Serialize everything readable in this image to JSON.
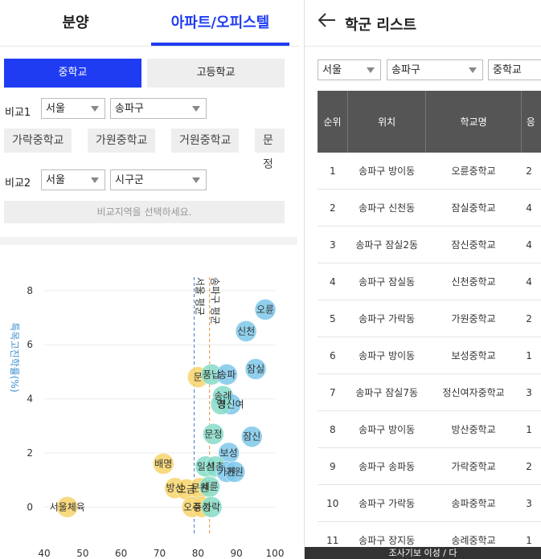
{
  "tabs": {
    "sale": "분양",
    "apt": "아파트/오피스텔"
  },
  "segment": {
    "middle": "중학교",
    "high": "고등학교"
  },
  "compare1": {
    "label": "비교1",
    "city": "서울",
    "district": "송파구"
  },
  "chips": [
    "가락중학교",
    "가원중학교",
    "거원중학교",
    "문정"
  ],
  "compare2": {
    "label": "비교2",
    "city": "서울",
    "district": "시구군"
  },
  "compare_message": "비교지역을 선택하세요.",
  "chart_data": {
    "type": "scatter",
    "ylabel": "특목고진학률(%)",
    "xlim": [
      40,
      100
    ],
    "ylim": [
      -1,
      8.5
    ],
    "xticks": [
      40,
      50,
      60,
      70,
      80,
      90,
      100
    ],
    "yticks": [
      0,
      2,
      4,
      6,
      8
    ],
    "reference_lines": [
      {
        "label": "서울 평균",
        "x": 79,
        "color": "#4a78c4"
      },
      {
        "label": "송파구 평균",
        "x": 83,
        "color": "#e0923a"
      }
    ],
    "points": [
      {
        "label": "오륜",
        "x": 97.5,
        "y": 7.3,
        "group": "blue"
      },
      {
        "label": "신천",
        "x": 92.5,
        "y": 6.5,
        "group": "blue"
      },
      {
        "label": "잠실",
        "x": 95,
        "y": 5.1,
        "group": "blue"
      },
      {
        "label": "문",
        "x": 80,
        "y": 4.8,
        "group": "yellow"
      },
      {
        "label": "풍납",
        "x": 83.5,
        "y": 4.9,
        "group": "teal"
      },
      {
        "label": "송파",
        "x": 87.5,
        "y": 4.9,
        "group": "blue"
      },
      {
        "label": "송례",
        "x": 86.5,
        "y": 4.1,
        "group": "teal"
      },
      {
        "label": "정신여",
        "x": 88.5,
        "y": 3.8,
        "group": "blue"
      },
      {
        "label": "영",
        "x": 86,
        "y": 3.8,
        "group": "teal"
      },
      {
        "label": "문정",
        "x": 84,
        "y": 2.7,
        "group": "teal"
      },
      {
        "label": "잠신",
        "x": 94,
        "y": 2.6,
        "group": "blue"
      },
      {
        "label": "보성",
        "x": 88,
        "y": 2.0,
        "group": "blue"
      },
      {
        "label": "배명",
        "x": 71,
        "y": 1.6,
        "group": "yellow"
      },
      {
        "label": "일신",
        "x": 82,
        "y": 1.5,
        "group": "teal"
      },
      {
        "label": "석촌",
        "x": 84.5,
        "y": 1.5,
        "group": "teal"
      },
      {
        "label": "가원",
        "x": 87.5,
        "y": 1.3,
        "group": "blue"
      },
      {
        "label": "거원",
        "x": 89.5,
        "y": 1.3,
        "group": "blue"
      },
      {
        "label": "방산",
        "x": 74,
        "y": 0.7,
        "group": "yellow"
      },
      {
        "label": "오금",
        "x": 77,
        "y": 0.65,
        "group": "yellow"
      },
      {
        "label": "문원",
        "x": 80.5,
        "y": 0.7,
        "group": "yellow"
      },
      {
        "label": "세륜",
        "x": 83,
        "y": 0.75,
        "group": "teal"
      },
      {
        "label": "오주",
        "x": 78.5,
        "y": 0.0,
        "group": "yellow"
      },
      {
        "label": "풍성",
        "x": 81,
        "y": 0.0,
        "group": "yellow"
      },
      {
        "label": "가락",
        "x": 83.5,
        "y": 0.0,
        "group": "teal"
      },
      {
        "label": "서울체육",
        "x": 46,
        "y": 0.0,
        "group": "yellow"
      }
    ],
    "colors": {
      "blue": "#7ec8ea",
      "teal": "#86dcc8",
      "yellow": "#f7d36a"
    }
  },
  "right": {
    "title": "학군 리스트",
    "filters": {
      "city": "서울",
      "district": "송파구",
      "level": "중학교"
    },
    "columns": [
      "순위",
      "위치",
      "학교명",
      "응"
    ],
    "rows": [
      [
        "1",
        "송파구 방이동",
        "오륜중학교",
        "2"
      ],
      [
        "2",
        "송파구 신천동",
        "잠실중학교",
        "4"
      ],
      [
        "3",
        "송파구 잠실2동",
        "잠신중학교",
        "4"
      ],
      [
        "4",
        "송파구 잠실동",
        "신천중학교",
        "4"
      ],
      [
        "5",
        "송파구 가락동",
        "가원중학교",
        "2"
      ],
      [
        "6",
        "송파구 방이동",
        "보성중학교",
        "1"
      ],
      [
        "7",
        "송파구 잠실7동",
        "정신여자중학교",
        "3"
      ],
      [
        "8",
        "송파구 방이동",
        "방산중학교",
        "1"
      ],
      [
        "9",
        "송파구 송파동",
        "가락중학교",
        "2"
      ],
      [
        "10",
        "송파구 가락동",
        "송파중학교",
        "3"
      ],
      [
        "11",
        "송파구 장지동",
        "송례중학교",
        "1"
      ]
    ],
    "bottom": "조사기보 이성 / 다"
  }
}
